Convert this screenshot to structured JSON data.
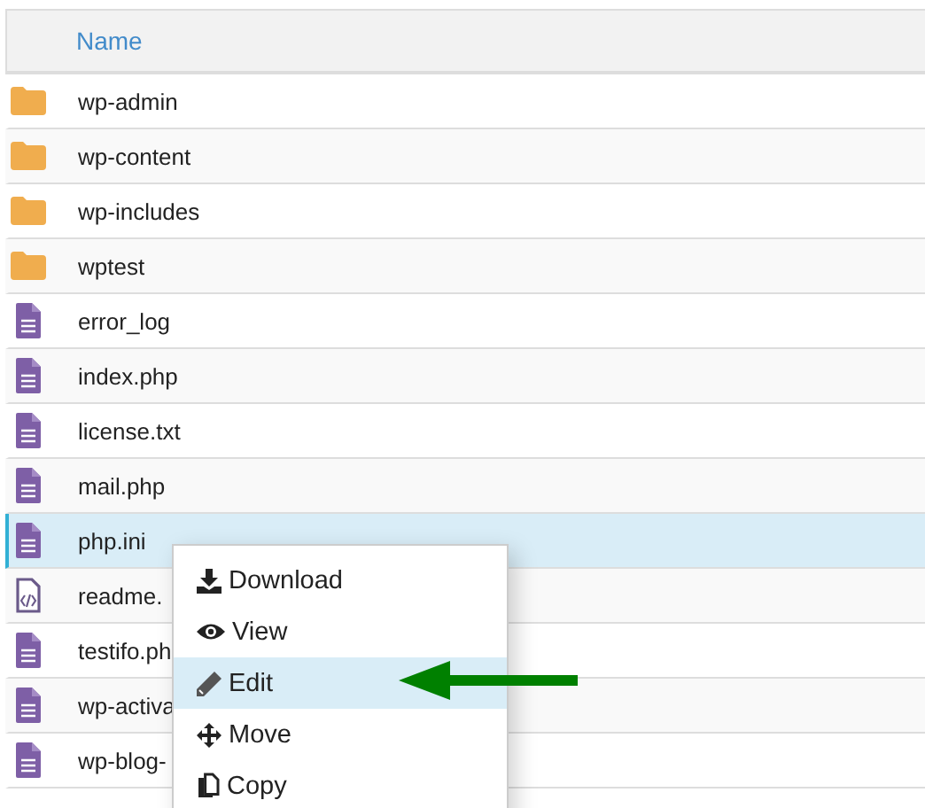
{
  "table": {
    "columns": [
      "Name"
    ],
    "rows": [
      {
        "name": "wp-admin",
        "kind": "folder",
        "selected": false
      },
      {
        "name": "wp-content",
        "kind": "folder",
        "selected": false
      },
      {
        "name": "wp-includes",
        "kind": "folder",
        "selected": false
      },
      {
        "name": "wptest",
        "kind": "folder",
        "selected": false
      },
      {
        "name": "error_log",
        "kind": "file",
        "selected": false
      },
      {
        "name": "index.php",
        "kind": "file",
        "selected": false
      },
      {
        "name": "license.txt",
        "kind": "file",
        "selected": false
      },
      {
        "name": "mail.php",
        "kind": "file",
        "selected": false
      },
      {
        "name": "php.ini",
        "kind": "file",
        "selected": true
      },
      {
        "name": "readme.",
        "kind": "code",
        "selected": false
      },
      {
        "name": "testifo.ph",
        "kind": "file",
        "selected": false
      },
      {
        "name": "wp-activa",
        "kind": "file",
        "selected": false
      },
      {
        "name": "wp-blog-",
        "kind": "file",
        "selected": false
      }
    ]
  },
  "context_menu": {
    "items": [
      {
        "label": "Download",
        "kind": "download",
        "selected": false
      },
      {
        "label": "View",
        "kind": "view",
        "selected": false
      },
      {
        "label": "Edit",
        "kind": "edit",
        "selected": true
      },
      {
        "label": "Move",
        "kind": "move",
        "selected": false
      },
      {
        "label": "Copy",
        "kind": "copy",
        "selected": false
      }
    ]
  }
}
